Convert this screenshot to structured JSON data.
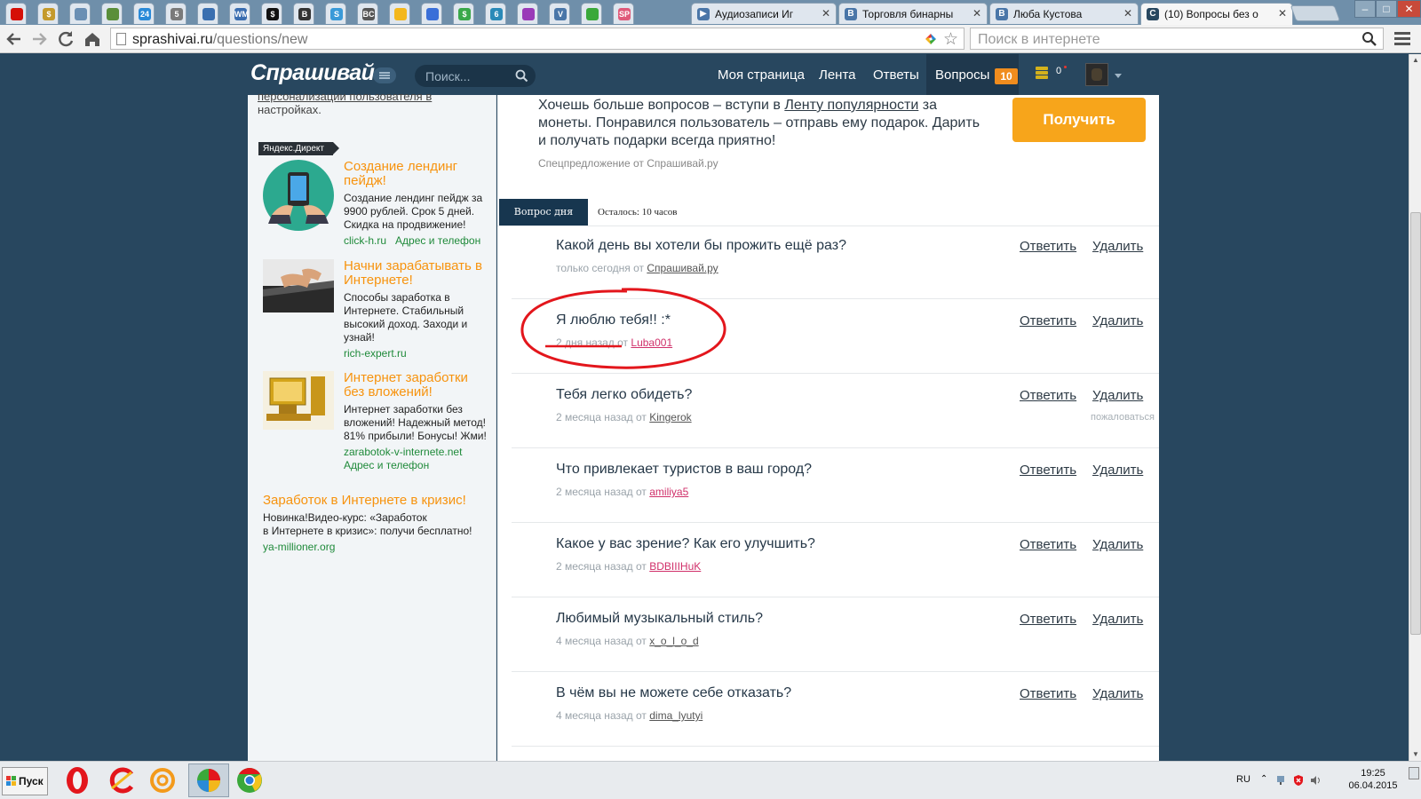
{
  "browser": {
    "pinned_tabs": [
      {
        "icon": "lastfm-icon",
        "color": "#d51007",
        "glyph": ""
      },
      {
        "icon": "money-bag-icon",
        "color": "#c49a2c",
        "glyph": "$"
      },
      {
        "icon": "email-icon",
        "color": "#6a8fb4",
        "glyph": ""
      },
      {
        "icon": "search-icon",
        "color": "#5a8e3a",
        "glyph": ""
      },
      {
        "icon": "number-24-icon",
        "color": "#2a8ad8",
        "glyph": "24"
      },
      {
        "icon": "number-5-icon",
        "color": "#7a7a7a",
        "glyph": "5"
      },
      {
        "icon": "refresh-icon",
        "color": "#3a6fb0",
        "glyph": ""
      },
      {
        "icon": "webmoney-icon",
        "color": "#3a6db0",
        "glyph": "WM"
      },
      {
        "icon": "dollar-icon",
        "color": "#111111",
        "glyph": "$"
      },
      {
        "icon": "bitcoin-icon",
        "color": "#333333",
        "glyph": "B"
      },
      {
        "icon": "letter-s-icon",
        "color": "#3a9ad8",
        "glyph": "S"
      },
      {
        "icon": "bc-icon",
        "color": "#555555",
        "glyph": "BC"
      },
      {
        "icon": "yellow-circle-icon",
        "color": "#f3b71c",
        "glyph": ""
      },
      {
        "icon": "globe-icon",
        "color": "#3a6fd8",
        "glyph": ""
      },
      {
        "icon": "dollar-green-icon",
        "color": "#3aa84a",
        "glyph": "$"
      },
      {
        "icon": "number-6-icon",
        "color": "#2a8ab8",
        "glyph": "6"
      },
      {
        "icon": "eye-icon",
        "color": "#9a3ab8",
        "glyph": ""
      },
      {
        "icon": "vk-icon",
        "color": "#4a76a8",
        "glyph": "V"
      },
      {
        "icon": "chat-icon",
        "color": "#3aa83a",
        "glyph": ""
      },
      {
        "icon": "sp-icon",
        "color": "#e05a7a",
        "glyph": "SP"
      }
    ],
    "tabs": [
      {
        "title": "Аудиозаписи Иг",
        "icon_color": "#4a76a8",
        "icon_glyph": "▶",
        "active": false
      },
      {
        "title": "Торговля бинарны",
        "icon_color": "#4a76a8",
        "icon_glyph": "B",
        "active": false
      },
      {
        "title": "Люба Кустова",
        "icon_color": "#4a76a8",
        "icon_glyph": "B",
        "active": false
      },
      {
        "title": "(10) Вопросы без о",
        "icon_color": "#28475f",
        "icon_glyph": "С",
        "active": true
      }
    ],
    "close_glyph": "✕",
    "url_host": "sprashivai.ru",
    "url_path": "/questions/new",
    "web_search_placeholder": "Поиск в интернете"
  },
  "site": {
    "logo": "Спрашивай",
    "search_placeholder": "Поиск...",
    "nav": [
      {
        "label": "Моя страница"
      },
      {
        "label": "Лента"
      },
      {
        "label": "Ответы"
      },
      {
        "label": "Вопросы"
      }
    ],
    "questions_badge": "10",
    "coins_count": "0"
  },
  "sidebar": {
    "cut_text_line1": "персонализации пользователя в",
    "cut_text_line2": "настройках.",
    "yandex_label": "Яндекс.Директ",
    "ads": [
      {
        "title": "Создание лендинг пейдж!",
        "description": "Создание лендинг пейдж за 9900 рублей. Срок 5 дней. Скидка на продвижение!",
        "domain": "click-h.ru",
        "contact": "Адрес и телефон"
      },
      {
        "title": "Начни зарабатывать в Интернете!",
        "description": "Способы заработка в Интернете. Стабильный высокий доход. Заходи и узнай!",
        "domain": "rich-expert.ru",
        "contact": ""
      },
      {
        "title": "Интернет заработки без вложений!",
        "description": "Интернет заработки без вложений! Надежный метод! 81% прибыли! Бонусы! Жми!",
        "domain": "zarabotok-v-internete.net",
        "contact": "Адрес и телефон"
      }
    ],
    "text_ad": {
      "title": "Заработок в Интернете в кризис!",
      "description_line1": "Новинка!Видео-курс: «Заработок",
      "description_line2": "в Интернете в кризис»: получи бесплатно!",
      "domain": "ya-millioner.org"
    }
  },
  "promo": {
    "text_before": "Хочешь больше вопросов – вступи в ",
    "link": "Ленту популярности",
    "text_after": " за монеты. Понравился пользователь – отправь ему подарок. Дарить и получать подарки всегда приятно!",
    "button": "Получить",
    "note": "Спецпредложение от Спрашивай.ру"
  },
  "question_of_day": {
    "tab": "Вопрос дня",
    "remaining": "Осталось: 10 часов"
  },
  "questions": [
    {
      "text": "Какой день вы хотели бы прожить ещё раз?",
      "time": "только сегодня от",
      "author": "Спрашивай.ру",
      "author_pink": false,
      "report": ""
    },
    {
      "text": "Я люблю тебя!! :*",
      "time": "2 дня назад от",
      "author": "Luba001",
      "author_pink": true,
      "report": ""
    },
    {
      "text": "Тебя легко обидеть?",
      "time": "2 месяца назад от",
      "author": "Kingerok",
      "author_pink": false,
      "report": "пожаловаться"
    },
    {
      "text": "Что привлекает туристов в ваш город?",
      "time": "2 месяца назад от",
      "author": "amiliya5",
      "author_pink": true,
      "report": ""
    },
    {
      "text": "Какое у вас зрение? Как его улучшить?",
      "time": "2 месяца назад от",
      "author": "BDBIIIHuK",
      "author_pink": true,
      "report": ""
    },
    {
      "text": "Любимый музыкальный стиль?",
      "time": "4 месяца назад от",
      "author": "x_o_l_o_d",
      "author_pink": false,
      "report": ""
    },
    {
      "text": "В чём вы не можете себе отказать?",
      "time": "4 месяца назад от",
      "author": "dima_lyutyi",
      "author_pink": false,
      "report": ""
    }
  ],
  "actions": {
    "answer": "Ответить",
    "delete": "Удалить"
  },
  "taskbar": {
    "start": "Пуск",
    "lang": "RU",
    "time": "19:25",
    "date": "06.04.2015"
  },
  "colors": {
    "header_bg": "#28475f",
    "accent_orange": "#f7a51b",
    "badge_orange": "#f08c1e",
    "ad_title": "#f7930e",
    "ad_domain": "#1f8a3a",
    "annotation_red": "#e3161c"
  }
}
